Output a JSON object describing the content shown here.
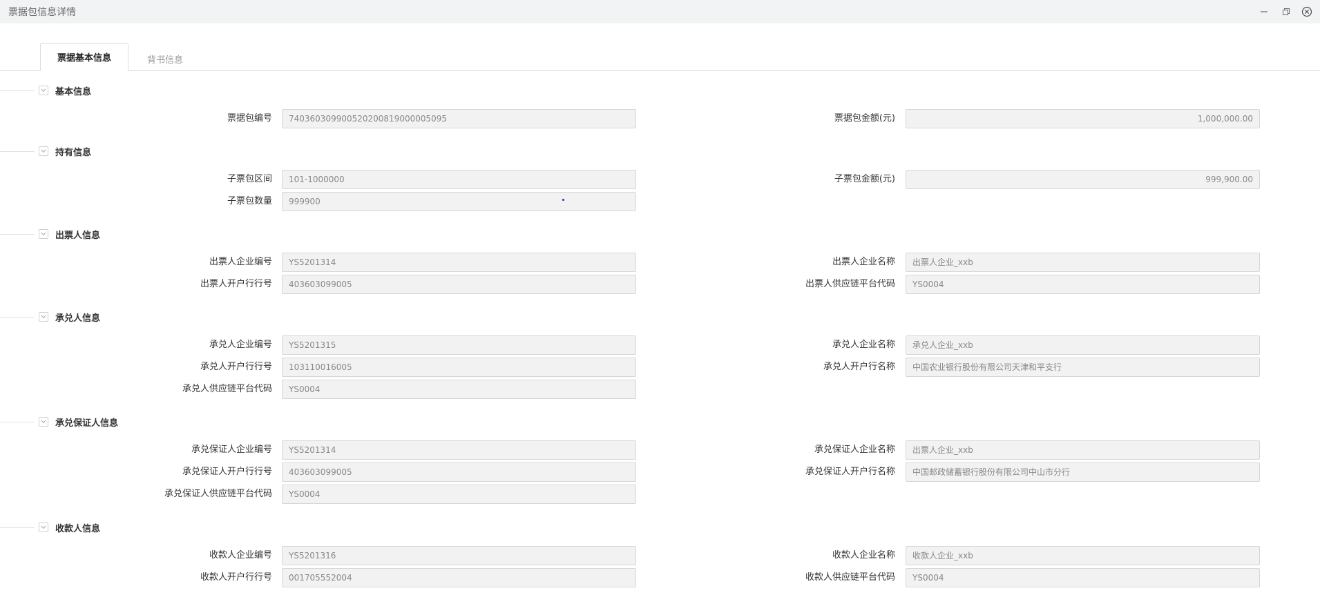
{
  "window": {
    "title": "票据包信息详情",
    "controls": [
      "minimize-icon",
      "restore-icon",
      "close-icon"
    ]
  },
  "tabs": [
    {
      "label": "票据基本信息",
      "active": true
    },
    {
      "label": "背书信息",
      "active": false
    }
  ],
  "sections": {
    "basic": {
      "title": "基本信息",
      "pkg_no_label": "票据包编号",
      "pkg_no": "740360309900520200819000005095",
      "pkg_amount_label": "票据包金额(元)",
      "pkg_amount": "1,000,000.00"
    },
    "holding": {
      "title": "持有信息",
      "sub_range_label": "子票包区间",
      "sub_range": "101-1000000",
      "sub_amount_label": "子票包金额(元)",
      "sub_amount": "999,900.00",
      "sub_count_label": "子票包数量",
      "sub_count": "999900"
    },
    "drawer": {
      "title": "出票人信息",
      "company_no_label": "出票人企业编号",
      "company_no": "YS5201314",
      "company_name_label": "出票人企业名称",
      "company_name": "出票人企业_xxb",
      "bank_no_label": "出票人开户行行号",
      "bank_no": "403603099005",
      "platform_code_label": "出票人供应链平台代码",
      "platform_code": "YS0004"
    },
    "acceptor": {
      "title": "承兑人信息",
      "company_no_label": "承兑人企业编号",
      "company_no": "YS5201315",
      "company_name_label": "承兑人企业名称",
      "company_name": "承兑人企业_xxb",
      "bank_no_label": "承兑人开户行行号",
      "bank_no": "103110016005",
      "bank_name_label": "承兑人开户行名称",
      "bank_name": "中国农业银行股份有限公司天津和平支行",
      "platform_code_label": "承兑人供应链平台代码",
      "platform_code": "YS0004"
    },
    "guarantor": {
      "title": "承兑保证人信息",
      "company_no_label": "承兑保证人企业编号",
      "company_no": "YS5201314",
      "company_name_label": "承兑保证人企业名称",
      "company_name": "出票人企业_xxb",
      "bank_no_label": "承兑保证人开户行行号",
      "bank_no": "403603099005",
      "bank_name_label": "承兑保证人开户行名称",
      "bank_name": "中国邮政储蓄银行股份有限公司中山市分行",
      "platform_code_label": "承兑保证人供应链平台代码",
      "platform_code": "YS0004"
    },
    "payee": {
      "title": "收款人信息",
      "company_no_label": "收款人企业编号",
      "company_no": "YS5201316",
      "company_name_label": "收款人企业名称",
      "company_name": "收款人企业_xxb",
      "bank_no_label": "收款人开户行行号",
      "bank_no": "001705552004",
      "platform_code_label": "收款人供应链平台代码",
      "platform_code": "YS0004"
    }
  }
}
